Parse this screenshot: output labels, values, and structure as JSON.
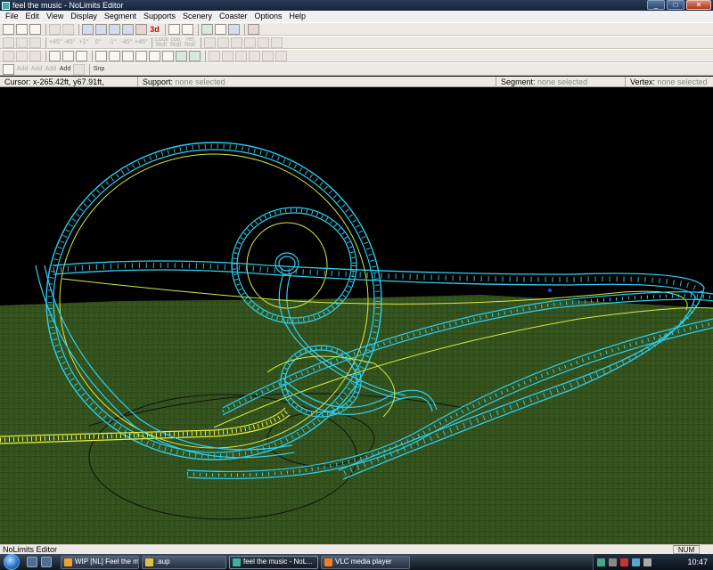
{
  "window": {
    "title": "feel the music - NoLimits Editor",
    "buttons": {
      "minimize": "_",
      "maximize": "□",
      "close": "✕"
    }
  },
  "menu": [
    "File",
    "Edit",
    "View",
    "Display",
    "Segment",
    "Supports",
    "Scenery",
    "Coaster",
    "Options",
    "Help"
  ],
  "toolbar": {
    "three_d_label": "3d",
    "roll_labels": [
      "+45°",
      "-45°",
      "+1°",
      "0°",
      "-1°",
      "-45°",
      "+45°"
    ],
    "roll_buttons": [
      {
        "top": "Lock",
        "bottom": "Roll"
      },
      {
        "top": "con",
        "bottom": "Roll"
      },
      {
        "top": "rel",
        "bottom": "Roll"
      }
    ],
    "add_labels": [
      "Add",
      "Add",
      "Add",
      "Add"
    ],
    "snap_label": "Snp"
  },
  "status": {
    "cursor_label": "Cursor:",
    "cursor_value": "x-265.42ft, y67.91ft,",
    "support_label": "Support:",
    "support_value": "none selected",
    "segment_label": "Segment:",
    "segment_value": "none selected",
    "vertex_label": "Vertex:",
    "vertex_value": "none selected"
  },
  "bottom_status": {
    "text": "NoLimits Editor",
    "num": "NUM"
  },
  "taskbar": {
    "tasks": [
      {
        "label": "WIP [NL] Feel the m...",
        "active": false,
        "icon_color": "#f0a030"
      },
      {
        "label": ".aup",
        "active": false,
        "icon_color": "#e0c040"
      },
      {
        "label": "feel the music - NoL...",
        "active": true,
        "icon_color": "#40b0a0"
      },
      {
        "label": "VLC media player",
        "active": false,
        "icon_color": "#f08020"
      }
    ],
    "clock": "10:47"
  },
  "colors": {
    "track": "#2fd0f0",
    "spine": "#e0f040",
    "ground_dark": "#233d13",
    "ground_light": "#3b5a22",
    "sky": "#000000"
  }
}
